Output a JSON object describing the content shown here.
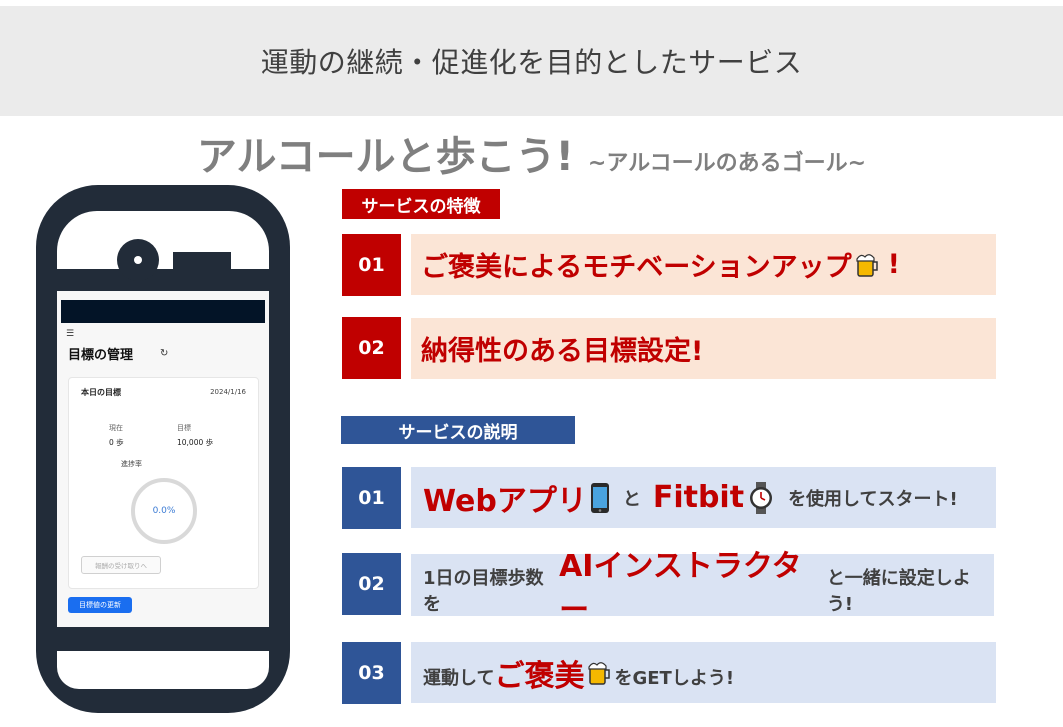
{
  "header": {
    "text": "運動の継続・促進化を目的としたサービス"
  },
  "title": {
    "main": "アルコールと歩こう!",
    "sub": "~アルコールのあるゴール~"
  },
  "app": {
    "menu_icon": "☰",
    "title": "目標の管理",
    "reload_icon": "↻",
    "card": {
      "title": "本日の目標",
      "date": "2024/1/16",
      "current_label": "現在",
      "current_value": "0 歩",
      "goal_label": "目標",
      "goal_value": "10,000 歩",
      "progress_label": "進捗率",
      "progress_value": "0.0%",
      "progress_fraction": 0.0,
      "reward_button": "報酬の受け取りへ"
    },
    "update_button": "目標値の更新"
  },
  "features": {
    "label": "サービスの特徴",
    "items": [
      {
        "num": "01",
        "text": "ご褒美によるモチベーションアップ",
        "icon": "beer-mug-icon",
        "suffix": "!"
      },
      {
        "num": "02",
        "text": "納得性のある目標設定!"
      }
    ]
  },
  "description": {
    "label": "サービスの説明",
    "items": [
      {
        "num": "01",
        "part1": "Webアプリ",
        "icon1": "smartphone-icon",
        "and": "と",
        "part2": "Fitbit",
        "icon2": "watch-icon",
        "rest": "を使用してスタート!"
      },
      {
        "num": "02",
        "pre": "1日の目標歩数を",
        "highlight": "AIインストラクター",
        "post": "と一緒に設定しよう!"
      },
      {
        "num": "03",
        "pre": "運動して",
        "highlight": "ご褒美",
        "icon": "beer-mug-icon",
        "post": "をGETしよう!"
      }
    ]
  },
  "colors": {
    "red": "#c00000",
    "navy": "#2f5597",
    "pink": "#fbe5d6",
    "light_blue": "#dae3f3",
    "phone": "#222c39"
  }
}
